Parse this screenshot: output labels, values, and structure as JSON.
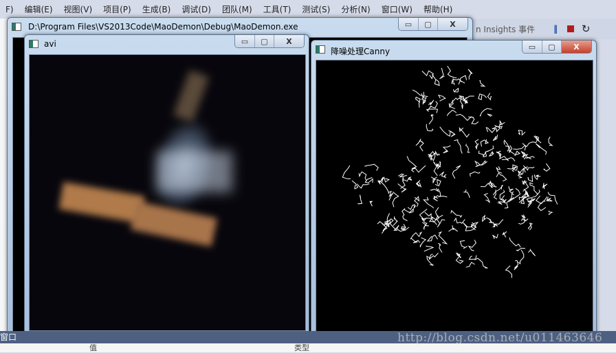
{
  "menu": [
    "F)",
    "编辑(E)",
    "视图(V)",
    "项目(P)",
    "生成(B)",
    "调试(D)",
    "团队(M)",
    "工具(T)",
    "测试(S)",
    "分析(N)",
    "窗口(W)",
    "帮助(H)"
  ],
  "toolbar_right": {
    "insights_label": "n Insights 事件",
    "icons": [
      "pause-icon",
      "stop-icon",
      "restart-icon"
    ]
  },
  "console_window": {
    "title": "D:\\Program Files\\VS2013Code\\MaoDemon\\Debug\\MaoDemon.exe"
  },
  "avi_window": {
    "title": "avi"
  },
  "canny_window": {
    "title": "降噪处理Canny"
  },
  "window_controls": {
    "minimize": "▭",
    "maximize": "▢",
    "close": "X"
  },
  "bottom_panel": {
    "title": "窗口",
    "col_value": "值",
    "col_type": "类型"
  },
  "watermark": "http://blog.csdn.net/u011463646"
}
